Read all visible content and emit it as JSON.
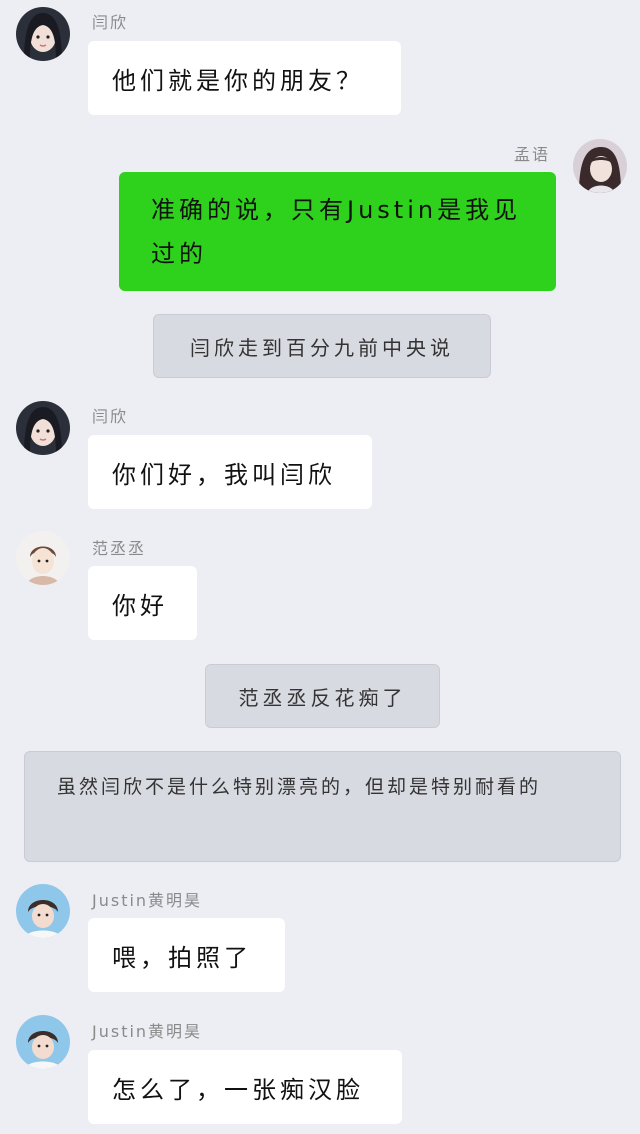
{
  "messages": [
    {
      "name": "闫欣",
      "text": "他们就是你的朋友？"
    },
    {
      "name": "孟语",
      "text": "准确的说，只有Justin是我见过的"
    },
    {
      "narration": "闫欣走到百分九前中央说"
    },
    {
      "name": "闫欣",
      "text": "你们好，我叫闫欣"
    },
    {
      "name": "范丞丞",
      "text": "你好"
    },
    {
      "narration": "范丞丞反花痴了"
    },
    {
      "narration": "虽然闫欣不是什么特别漂亮的，但却是特别耐看的"
    },
    {
      "name": "Justin黄明昊",
      "text": "喂，拍照了"
    },
    {
      "name": "Justin黄明昊",
      "text": "怎么了，一张痴汉脸"
    }
  ],
  "colors": {
    "background": "#edeef3",
    "self_bubble": "#2ed11b",
    "other_bubble": "#ffffff",
    "narration_bg": "#d8dae1"
  },
  "icons": [
    "avatar-yanxin",
    "avatar-mengyu",
    "avatar-fanchengcheng",
    "avatar-justin"
  ]
}
